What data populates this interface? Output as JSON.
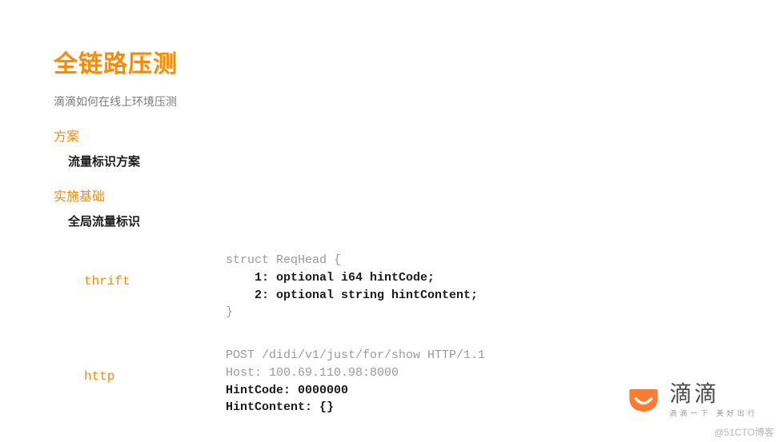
{
  "title": "全链路压测",
  "subtitle": "滴滴如何在线上环境压测",
  "section1": {
    "header": "方案",
    "item": "流量标识方案"
  },
  "section2": {
    "header": "实施基础",
    "item": "全局流量标识"
  },
  "code": {
    "label1": "thrift",
    "thrift_l1": "struct ReqHead {",
    "thrift_l2": "    1: optional i64 hintCode;",
    "thrift_l3": "    2: optional string hintContent;",
    "thrift_l4": "}",
    "label2": "http",
    "http_l1": "POST /didi/v1/just/for/show HTTP/1.1",
    "http_l2": "Host: 100.69.110.98:8000",
    "http_l3": "HintCode: 0000000",
    "http_l4": "HintContent: {}"
  },
  "logo": {
    "main": "滴滴",
    "sub": "滴滴一下 美好出行"
  },
  "watermark": "@51CTO博客"
}
